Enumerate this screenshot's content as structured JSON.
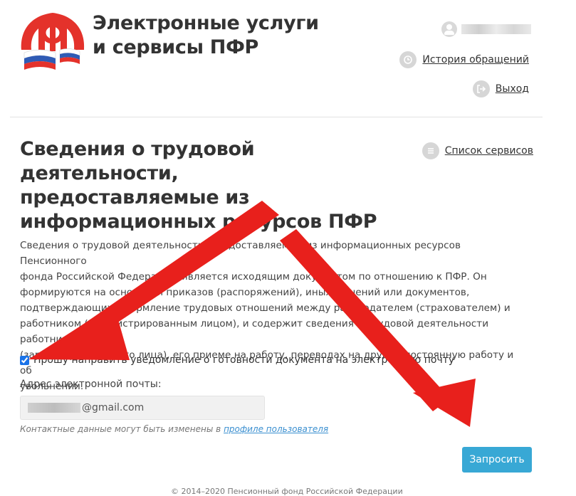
{
  "header": {
    "site_title_line1": "Электронные услуги",
    "site_title_line2": "и сервисы ПФР",
    "history_link": "История обращений",
    "logout_link": "Выход"
  },
  "page": {
    "title_line1": "Сведения о трудовой деятельности,",
    "title_line2": "предоставляемые из",
    "title_line3": "информационных ресурсов ПФР",
    "services_link": "Список сервисов",
    "description_lines": [
      "Сведения о трудовой деятельности, предоставляемые из информационных ресурсов Пенсионного",
      "фонда Российской Федерации, является исходящим документом по отношению к ПФР. Он",
      "формируются на основании приказов (распоряжений), иных решений или документов,",
      "подтверждающих оформление трудовых отношений между работодателем (страхователем) и",
      "работником (зарегистрированным лицом), и содержит сведения о трудовой деятельности работника",
      "(зарегистрированного лица), его приеме на работу, переводах на другую постоянную работу и об",
      "увольнении."
    ],
    "notify_checkbox_label": "Прошу направить уведомление о готовности документа на электронную почту",
    "notify_checked": true,
    "email_label": "Адрес электронной почты:",
    "email_visible_part": "@gmail.com",
    "contact_note": "Контактные данные могут быть изменены в",
    "contact_link": "профиле пользователя",
    "submit_button": "Запросить"
  },
  "footer": {
    "copyright": "© 2014–2020 Пенсионный фонд Российской Федерации"
  },
  "colors": {
    "accent": "#38a8d5",
    "logo_red": "#e4322b",
    "arrow_red": "#e8201c",
    "link_blue": "#3a8fd0"
  }
}
